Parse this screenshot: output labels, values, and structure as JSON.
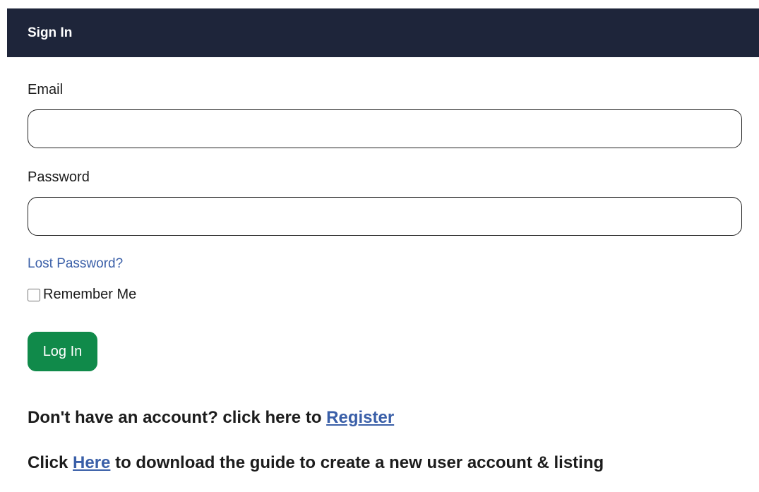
{
  "header": {
    "title": "Sign In",
    "background_color": "#1e253a"
  },
  "form": {
    "email_label": "Email",
    "email_value": "",
    "password_label": "Password",
    "password_value": "",
    "lost_password_link": "Lost Password?",
    "remember_label": "Remember Me",
    "remember_checked": false,
    "login_button_label": "Log In",
    "login_button_color": "#108a4a",
    "link_color": "#3a5fa8"
  },
  "footer": {
    "register_prefix": "Don't have an account? click here to ",
    "register_link": "Register",
    "guide_prefix": "Click ",
    "guide_link": "Here",
    "guide_suffix": " to download the guide to create a new user account & listing"
  }
}
